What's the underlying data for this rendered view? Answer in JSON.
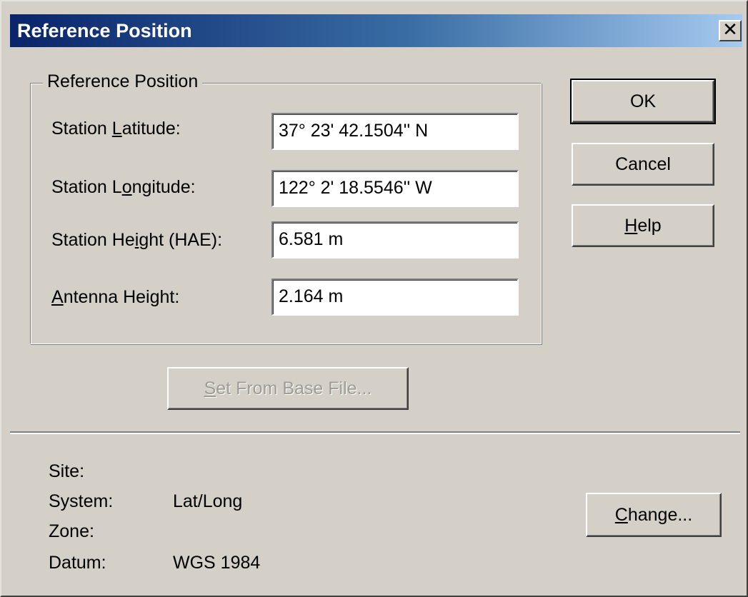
{
  "window": {
    "title": "Reference Position",
    "close_glyph": "✕"
  },
  "group": {
    "legend": "Reference Position",
    "fields": [
      {
        "label_pre": "Station ",
        "label_key": "L",
        "label_post": "atitude:",
        "value": "37° 23' 42.1504'' N"
      },
      {
        "label_pre": "Station L",
        "label_key": "o",
        "label_post": "ngitude:",
        "value": "122° 2' 18.5546'' W"
      },
      {
        "label_pre": "Station He",
        "label_key": "i",
        "label_post": "ght (HAE):",
        "value": "6.581 m"
      },
      {
        "label_pre": "",
        "label_key": "A",
        "label_post": "ntenna Height:",
        "value": "2.164 m"
      }
    ]
  },
  "buttons": {
    "ok": "OK",
    "cancel": "Cancel",
    "help_key": "H",
    "help_rest": "elp",
    "set_from_base_key": "S",
    "set_from_base_rest": "et From Base File...",
    "change_key": "C",
    "change_rest": "hange..."
  },
  "info": {
    "site_label": "Site:",
    "site_value": "",
    "system_label": "System:",
    "system_value": "Lat/Long",
    "zone_label": "Zone:",
    "zone_value": "",
    "datum_label": "Datum:",
    "datum_value": "WGS 1984"
  }
}
